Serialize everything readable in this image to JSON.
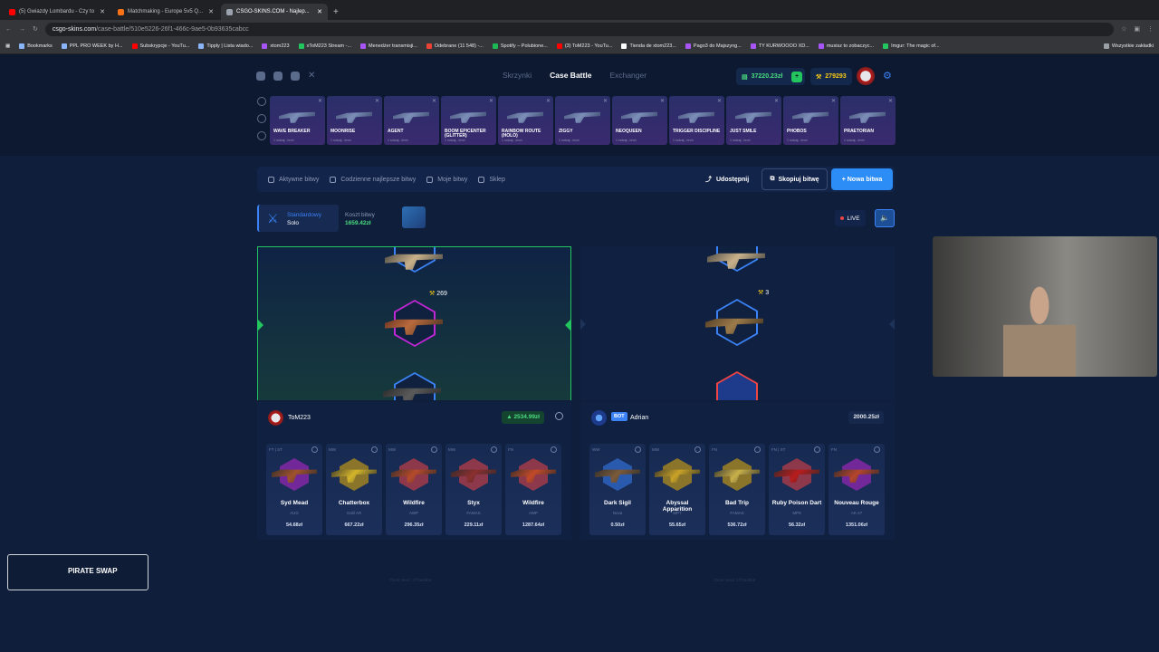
{
  "browser": {
    "tabs": [
      {
        "label": "(5) Gwiazdy Lombardu - Czy to",
        "color": "#ff0000",
        "active": false
      },
      {
        "label": "Matchmaking - Europe 5v5 Q...",
        "color": "#f97316",
        "active": false
      },
      {
        "label": "CSGO-SKINS.COM - Najlep...",
        "color": "#9ca3af",
        "active": true
      }
    ],
    "url_host": "csgo-skins.com",
    "url_path": "/case-battle/510e5226-26f1-466c-9ae5-0b93635cabcc",
    "bookmarks": [
      "Bookmarks",
      "PPL PRO WEEK by H...",
      "Subskrypcje - YouTu...",
      "Tipply | Lista wiado...",
      "xtom223",
      "xToM223 Stream -...",
      "Menedżer transmisji...",
      "Odebrane (11 548) -...",
      "Spotify – Polubione...",
      "(3) ToM223 - YouTu...",
      "Tienda de xtom223...",
      "Pago3 do Majszyng...",
      "TY KURWOOOO XD...",
      "musisz to zobaczyc...",
      "Imgur: The magic of..."
    ],
    "bookmarks_right": "Wszystkie zakładki"
  },
  "nav": {
    "items": [
      "Skrzynki",
      "Case Battle",
      "Exchanger"
    ],
    "active": "Case Battle"
  },
  "balance": "37220.23zł",
  "points": "279293",
  "cases": [
    {
      "name": "WAVE BREAKER",
      "sub": "1 rodzaj - broń"
    },
    {
      "name": "MOONRISE",
      "sub": "1 rodzaj - broń"
    },
    {
      "name": "AGENT",
      "sub": "1 rodzaj - broń"
    },
    {
      "name": "BOOM EPICENTER (GLITTER)",
      "sub": "1 rodzaj - broń"
    },
    {
      "name": "RAINBOW ROUTE (HOLO)",
      "sub": "1 rodzaj - broń"
    },
    {
      "name": "ZIGGY",
      "sub": "1 rodzaj - broń"
    },
    {
      "name": "NEOQUEEN",
      "sub": "1 rodzaj - broń"
    },
    {
      "name": "TRIGGER DISCIPLINE",
      "sub": "1 rodzaj - broń"
    },
    {
      "name": "JUST SMILE",
      "sub": "1 rodzaj - broń"
    },
    {
      "name": "PHOBOS",
      "sub": "1 rodzaj - broń"
    },
    {
      "name": "PRAETORIAN",
      "sub": "1 rodzaj - broń"
    }
  ],
  "actions": {
    "active_battles": "Aktywne bitwy",
    "daily_best": "Codzienne najlepsze bitwy",
    "my_battles": "Moje bitwy",
    "shop": "Sklep",
    "share": "Udostępnij",
    "copy": "Skopiuj bitwę",
    "new": "+ Nowa bitwa"
  },
  "battle": {
    "mode_label": "Standardowy",
    "mode_value": "Solo",
    "cost_label": "Koszt bitwy",
    "cost_value": "1659.42zł",
    "live": "LIVE"
  },
  "reels": {
    "left_pick": "269",
    "right_pick": "3"
  },
  "players": [
    {
      "name": "ToM223",
      "total": "2534.99zł",
      "total_color": "#4ade80",
      "items": [
        {
          "wear": "FT | ST",
          "name": "Syd Mead",
          "type": "AUG",
          "price": "54.68zł",
          "color": "#c026d3",
          "gun": "#a0522d"
        },
        {
          "wear": "MW",
          "name": "Chatterbox",
          "type": "Galil AR",
          "price": "667.22zł",
          "color": "#eab308",
          "gun": "#d4b52a"
        },
        {
          "wear": "MW",
          "name": "Wildfire",
          "type": "AWP",
          "price": "296.35zł",
          "color": "#ef4444",
          "gun": "#b64a2a"
        },
        {
          "wear": "MW",
          "name": "Styx",
          "type": "FAMAS",
          "price": "229.11zł",
          "color": "#ef4444",
          "gun": "#8b2f2f"
        },
        {
          "wear": "FN",
          "name": "Wildfire",
          "type": "AWP",
          "price": "1287.64zł",
          "color": "#ef4444",
          "gun": "#c24a28"
        }
      ]
    },
    {
      "name": "Adrian",
      "bot_label": "BOT",
      "total": "2000.25zł",
      "total_color": "#e5e7eb",
      "items": [
        {
          "wear": "WW",
          "name": "Dark Sigil",
          "type": "Nova",
          "price": "0.50zł",
          "color": "#3b82f6",
          "gun": "#7a5a3a"
        },
        {
          "wear": "MW",
          "name": "Abyssal Apparition",
          "type": "MP7",
          "price": "55.65zł",
          "color": "#eab308",
          "gun": "#c9a227"
        },
        {
          "wear": "FN",
          "name": "Bad Trip",
          "type": "FAMAS",
          "price": "536.72zł",
          "color": "#eab308",
          "gun": "#c8b04a"
        },
        {
          "wear": "FN | ST",
          "name": "Ruby Poison Dart",
          "type": "MP9",
          "price": "56.32zł",
          "color": "#ef4444",
          "gun": "#b91c1c"
        },
        {
          "wear": "FN",
          "name": "Nouveau Rouge",
          "type": "AK-47",
          "price": "1351.06zł",
          "color": "#c026d3",
          "gun": "#b5452c"
        }
      ]
    }
  ],
  "footer": {
    "left": "Client seed: 17f3ad9b6",
    "right": "Client seed: 17f3ad9b6"
  },
  "logo_text": "PIRATE SWAP"
}
